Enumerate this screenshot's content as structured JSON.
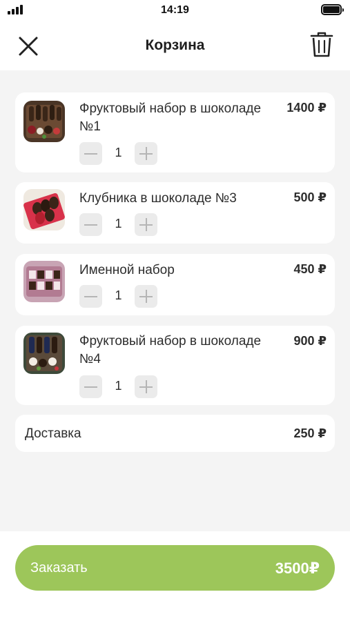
{
  "status_bar": {
    "time": "14:19"
  },
  "header": {
    "title": "Корзина"
  },
  "cart": {
    "items": [
      {
        "name": "Фруктовый набор в шоколаде №1",
        "price": "1400 ₽",
        "quantity": "1",
        "image": "fruit-chocolate-set-photo"
      },
      {
        "name": "Клубника в шоколаде №3",
        "price": "500 ₽",
        "quantity": "1",
        "image": "strawberries-in-chocolate-photo"
      },
      {
        "name": "Именной набор",
        "price": "450 ₽",
        "quantity": "1",
        "image": "named-set-photo"
      },
      {
        "name": "Фруктовый набор в шоколаде №4",
        "price": "900 ₽",
        "quantity": "1",
        "image": "fruit-chocolate-set-photo"
      }
    ],
    "delivery": {
      "label": "Доставка",
      "price": "250 ₽"
    }
  },
  "order_button": {
    "label": "Заказать",
    "total": "3500₽"
  },
  "colors": {
    "accent": "#9dc65a",
    "background": "#f4f4f4",
    "card": "#ffffff",
    "qty_button": "#ebebeb"
  }
}
